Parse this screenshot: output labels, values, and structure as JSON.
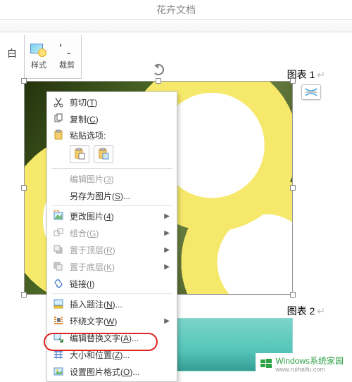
{
  "title": "花卉文档",
  "ribbon": {
    "side_label": "白",
    "style": "样式",
    "crop": "裁剪"
  },
  "captions": {
    "c1_prefix": "图表 ",
    "c1_num": "1",
    "c2_prefix": "图表 ",
    "c2_num": "2"
  },
  "context_menu": {
    "cut": {
      "label_pre": "剪切(",
      "mn": "T",
      "label_post": ")"
    },
    "copy": {
      "label_pre": "复制(",
      "mn": "C",
      "label_post": ")"
    },
    "paste_header": "粘贴选项:",
    "edit_picture": {
      "label_pre": "编辑图片(",
      "mn": "3",
      "label_post": ")"
    },
    "save_as_picture": {
      "label_pre": "另存为图片(",
      "mn": "S",
      "label_post": ")..."
    },
    "change_picture": {
      "label_pre": "更改图片(",
      "mn": "4",
      "label_post": ")"
    },
    "group": {
      "label_pre": "组合(",
      "mn": "G",
      "label_post": ")"
    },
    "bring_front": {
      "label_pre": "置于顶层(",
      "mn": "R",
      "label_post": ")"
    },
    "send_back": {
      "label_pre": "置于底层(",
      "mn": "K",
      "label_post": ")"
    },
    "link": {
      "label_pre": "链接(",
      "mn": "I",
      "label_post": ")"
    },
    "insert_caption": {
      "label_pre": "插入题注(",
      "mn": "N",
      "label_post": ")..."
    },
    "wrap_text": {
      "label_pre": "环绕文字(",
      "mn": "W",
      "label_post": ")"
    },
    "edit_alt": {
      "label_pre": "编辑替换文字(",
      "mn": "A",
      "label_post": ")..."
    },
    "size_position": {
      "label_pre": "大小和位置(",
      "mn": "Z",
      "label_post": ")..."
    },
    "format_picture": {
      "label_pre": "设置图片格式(",
      "mn": "O",
      "label_post": ")..."
    }
  },
  "watermark": {
    "line1": "Windows系统家园",
    "line2": "www.ruihaifu.com"
  }
}
